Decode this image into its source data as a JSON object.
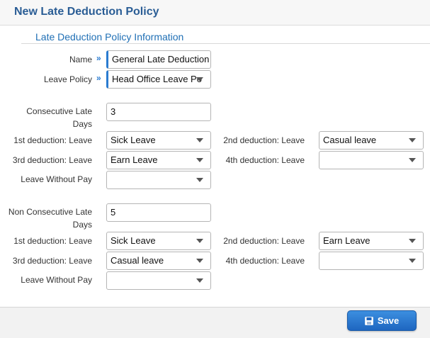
{
  "header": {
    "title": "New Late Deduction Policy"
  },
  "section": {
    "title": "Late Deduction Policy Information"
  },
  "fields": {
    "name_label": "Name",
    "name_value": "General Late Deduction",
    "leave_policy_label": "Leave Policy",
    "leave_policy_value": "Head Office Leave Po"
  },
  "consecutive": {
    "label_line1": "Consecutive Late",
    "label_line2": "Days",
    "days_value": "3",
    "first_label": "1st deduction: Leave",
    "first_value": "Sick Leave",
    "second_label": "2nd deduction: Leave",
    "second_value": "Casual leave",
    "third_label": "3rd deduction: Leave",
    "third_value": "Earn Leave",
    "fourth_label": "4th deduction: Leave",
    "fourth_value": "",
    "lwp_label": "Leave Without Pay",
    "lwp_value": ""
  },
  "non_consecutive": {
    "label_line1": "Non Consecutive Late",
    "label_line2": "Days",
    "days_value": "5",
    "first_label": "1st deduction: Leave",
    "first_value": "Sick Leave",
    "second_label": "2nd deduction: Leave",
    "second_value": "Earn Leave",
    "third_label": "3rd deduction: Leave",
    "third_value": "Casual leave",
    "fourth_label": "4th deduction: Leave",
    "fourth_value": "",
    "lwp_label": "Leave Without Pay",
    "lwp_value": ""
  },
  "required_marker": "»",
  "footer": {
    "save_label": "Save"
  },
  "icons": {
    "save": "floppy-disk-icon",
    "dropdown": "chevron-down-icon"
  },
  "colors": {
    "title": "#2a5d95",
    "accent": "#1f6fb5",
    "button": "#1e66c0"
  }
}
